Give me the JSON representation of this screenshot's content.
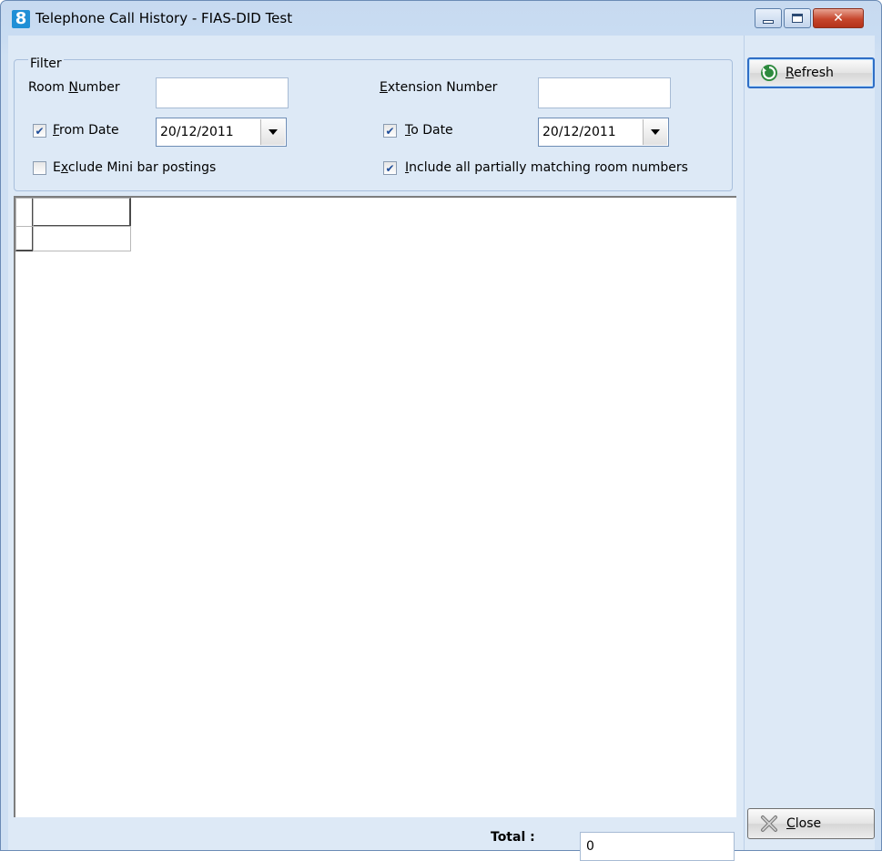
{
  "window": {
    "title": "Telephone Call History - FIAS-DID Test",
    "app_icon_text": "8"
  },
  "filter": {
    "legend": "Filter",
    "room_number": {
      "label_pre": "Room ",
      "label_u": "N",
      "label_post": "umber",
      "value": ""
    },
    "extension_number": {
      "label_pre": "",
      "label_u": "E",
      "label_post": "xtension Number",
      "value": ""
    },
    "from_date": {
      "checked": true,
      "label_pre": "",
      "label_u": "F",
      "label_post": "rom Date",
      "value": "20/12/2011"
    },
    "to_date": {
      "checked": true,
      "label_pre": "",
      "label_u": "T",
      "label_post": "o Date",
      "value": "20/12/2011"
    },
    "exclude_minibar": {
      "checked": false,
      "label_pre": "E",
      "label_u": "x",
      "label_post": "clude Mini bar postings"
    },
    "include_partial": {
      "checked": true,
      "label_pre": "",
      "label_u": "I",
      "label_post": "nclude all partially matching room numbers"
    }
  },
  "footer": {
    "total_label": "Total :",
    "total_value": "0"
  },
  "buttons": {
    "refresh": {
      "label_u": "R",
      "label_post": "efresh"
    },
    "close": {
      "label_u": "C",
      "label_post": "lose"
    }
  },
  "colors": {
    "accent": "#2f6ec6",
    "panel": "#dde9f6",
    "close_caption": "#c6462c"
  }
}
